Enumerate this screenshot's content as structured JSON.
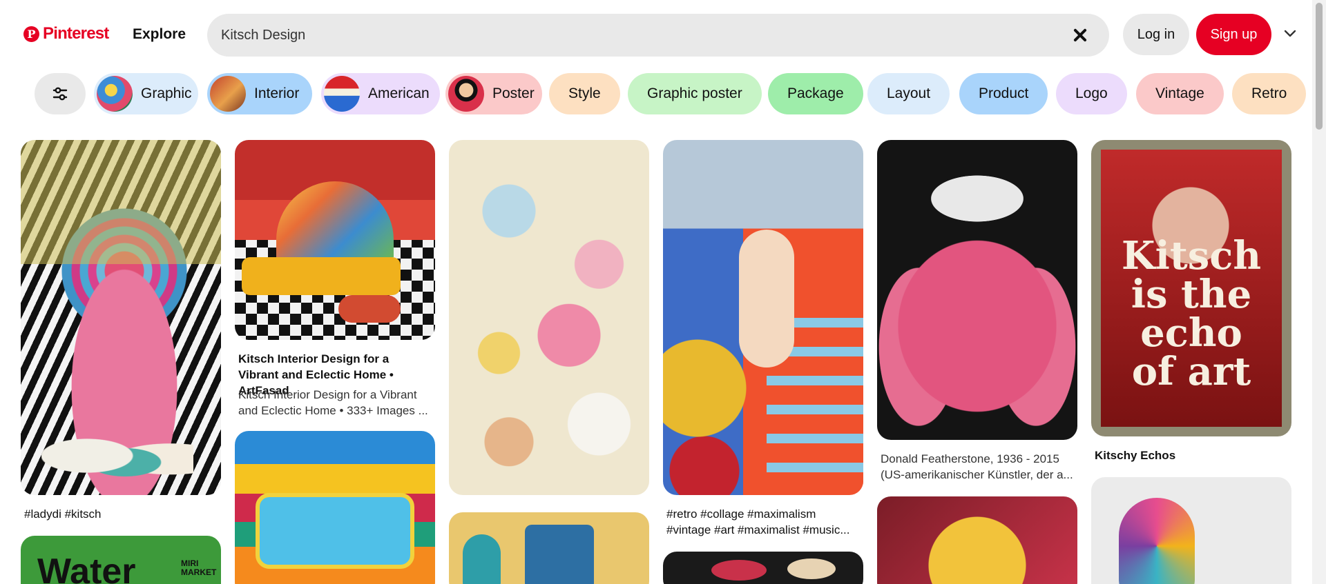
{
  "header": {
    "logo_text": "Pinterest",
    "explore_label": "Explore",
    "search_value": "Kitsch Design",
    "login_label": "Log in",
    "signup_label": "Sign up"
  },
  "chips": [
    {
      "label": "Graphic",
      "bg": "#dcecfb"
    },
    {
      "label": "Interior",
      "bg": "#a9d4fb"
    },
    {
      "label": "American",
      "bg": "#ecdcfc"
    },
    {
      "label": "Poster",
      "bg": "#fbc9c9"
    },
    {
      "label": "Style",
      "bg": "#fde0c1"
    },
    {
      "label": "Graphic poster",
      "bg": "#c7f4c6"
    },
    {
      "label": "Package",
      "bg": "#9eedaa"
    },
    {
      "label": "Layout",
      "bg": "#dcecfb"
    },
    {
      "label": "Product",
      "bg": "#a9d4fb"
    },
    {
      "label": "Logo",
      "bg": "#ecdcfc"
    },
    {
      "label": "Vintage",
      "bg": "#fbc9c9"
    },
    {
      "label": "Retro",
      "bg": "#fde0c1"
    }
  ],
  "pins": {
    "col1_caption": "#ladydi #kitsch",
    "col1_next_text": "Water",
    "col1_next_small": "MIRI MARKET",
    "col2_title": "Kitsch Interior Design for a Vibrant and Eclectic Home • ArtFasad",
    "col2_desc": "Kitsch Interior Design for a Vibrant and Eclectic Home • 333+ Images ...",
    "col4_caption": "#retro #collage #maximalism #vintage #art #maximalist #music...",
    "col5_caption": "Donald Featherstone, 1936 - 2015 (US-amerikanischer Künstler, der a...",
    "col6_caption": "Kitschy Echos",
    "col6_poster_text": "Kitsch is the echo of art"
  },
  "colors": {
    "brand": "#e60023",
    "search_bg": "#e9e9e9"
  },
  "icons": [
    "pinterest-logo-icon",
    "clear-search-icon",
    "chevron-down-icon",
    "filter-sliders-icon"
  ]
}
